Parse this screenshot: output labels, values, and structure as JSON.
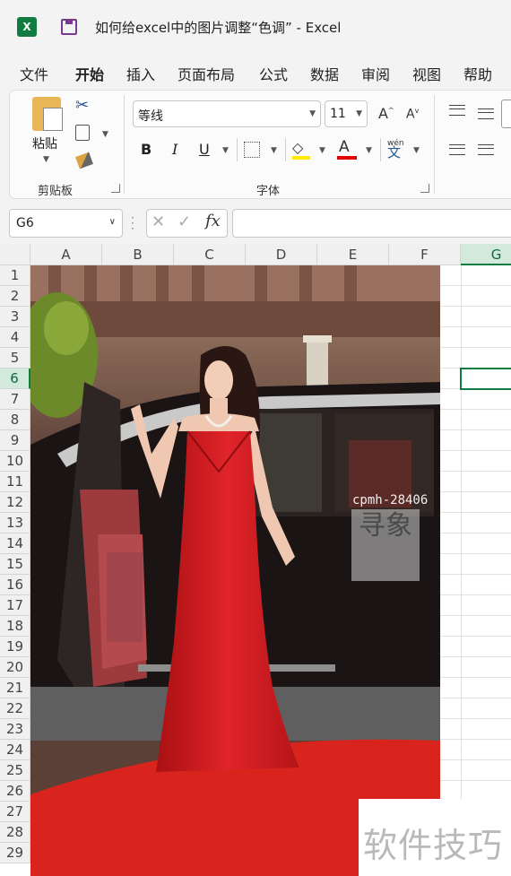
{
  "titlebar": {
    "title": "如何给excel中的图片调整“色调” - Excel",
    "app_icon_letter": "X"
  },
  "menu": [
    "文件",
    "开始",
    "插入",
    "页面布局",
    "公式",
    "数据",
    "审阅",
    "视图",
    "帮助"
  ],
  "menu_active": "开始",
  "ribbon": {
    "clipboard": {
      "paste_label": "粘贴",
      "group_label": "剪贴板"
    },
    "font": {
      "font_name": "等线",
      "font_size": "11",
      "bold": "B",
      "italic": "I",
      "underline": "U",
      "grow": "A",
      "shrink": "A",
      "font_color_glyph": "A",
      "phonetic_top": "wén",
      "phonetic_bottom": "文",
      "group_label": "字体"
    }
  },
  "formula_bar": {
    "namebox": "G6",
    "fx_label": "fx",
    "cancel_glyph": "✕",
    "enter_glyph": "✓",
    "content": ""
  },
  "columns": [
    "A",
    "B",
    "C",
    "D",
    "E",
    "F",
    "G"
  ],
  "selected_column": "G",
  "rows": [
    "1",
    "2",
    "3",
    "4",
    "5",
    "6",
    "7",
    "8",
    "9",
    "10",
    "11",
    "12",
    "13",
    "14",
    "15",
    "16",
    "17",
    "18",
    "19",
    "20",
    "21",
    "22",
    "23",
    "24",
    "25",
    "26",
    "27",
    "28",
    "29"
  ],
  "selected_row": "6",
  "image": {
    "stamp_code": "cpmh-28406",
    "stamp_glyphs": "寻象"
  },
  "watermark": {
    "text": "软件技巧"
  },
  "colors": {
    "excel_green": "#107c41",
    "fill_yellow": "#ffeb00",
    "font_red": "#e00000",
    "dress_red": "#d31a1d",
    "carpet_red": "#d8241d"
  },
  "icons": [
    "excel-app-icon",
    "save-icon",
    "paste-icon",
    "scissors-icon",
    "copy-icon",
    "format-painter-icon",
    "grow-font-icon",
    "shrink-font-icon",
    "border-icon",
    "fill-color-icon",
    "font-color-icon",
    "phonetic-icon",
    "align-icon",
    "cancel-icon",
    "enter-icon",
    "fx-icon",
    "dots-icon"
  ]
}
